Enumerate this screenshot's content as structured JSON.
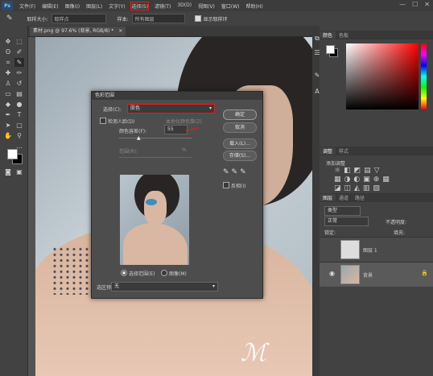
{
  "menubar": {
    "logo": "Ps",
    "items": [
      "文件(F)",
      "编辑(E)",
      "图像(I)",
      "图层(L)",
      "文字(Y)",
      "选择(S)",
      "滤镜(T)",
      "3D(D)",
      "视图(V)",
      "窗口(W)",
      "帮助(H)"
    ],
    "highlighted_index": 5,
    "window_controls": [
      "—",
      "☐",
      "✕"
    ]
  },
  "options": {
    "sample_size_label": "取样大小:",
    "sample_size_value": "取样点",
    "sample_label": "样本:",
    "sample_value": "所有图层",
    "show_ring_label": "显示取样环"
  },
  "document": {
    "tab_label": "素材.png @ 97.6% (背景, RGB/8) *",
    "close": "×"
  },
  "dialog": {
    "title": "色彩范围",
    "select_label": "选择(C):",
    "select_value": "肤色",
    "detect_faces_label": "检测人脸(D)",
    "localized_label": "本地化颜色簇(Z)",
    "fuzziness_label": "颜色容差(F):",
    "fuzziness_value": "55",
    "range_label": "范围(R):",
    "range_unit": "%",
    "ok": "确定",
    "cancel": "取消",
    "load": "载入(L)...",
    "save": "存储(S)...",
    "invert_label": "反相(I)",
    "selection_radio": "选择范围(E)",
    "image_radio": "图像(M)",
    "preview_label": "选区预览:",
    "preview_value": "无"
  },
  "panels": {
    "color_tabs": [
      "颜色",
      "色板"
    ],
    "adjust_tabs": [
      "调整",
      "样式"
    ],
    "adjust_title": "添加调整",
    "layer_tabs": [
      "图层",
      "通道",
      "路径"
    ],
    "kind_label": "类型",
    "mode_label": "正常",
    "opacity_label": "不透明度:",
    "fill_label": "填充:",
    "lock_label": "锁定:",
    "layers": [
      {
        "name": "图层 1",
        "visible": false
      },
      {
        "name": "背景",
        "visible": true,
        "locked": true
      }
    ]
  },
  "colors": {
    "foreground": "#ffffff",
    "background": "#000000",
    "highlight": "#e02020"
  }
}
